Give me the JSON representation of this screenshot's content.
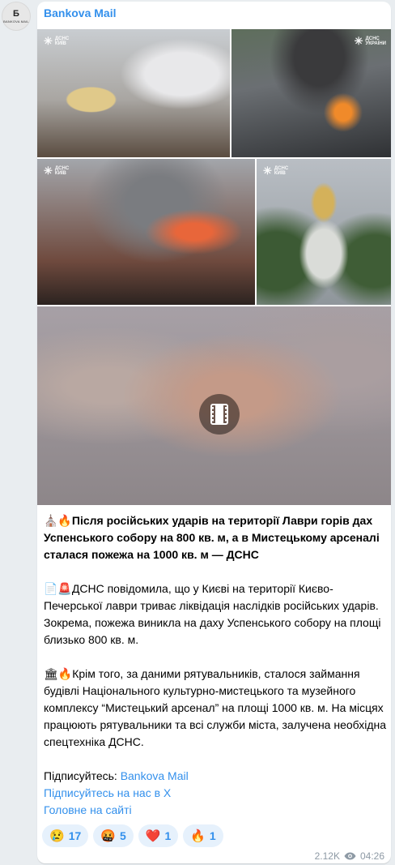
{
  "channel": {
    "name": "Bankova Mail",
    "avatar_glyph": "Б",
    "avatar_caption": "BANKOVA MAIL"
  },
  "photos": {
    "watermark_top": "ДСНС",
    "watermark_kyiv": "КИЇВ",
    "watermark_ukr": "УКРАЇНИ"
  },
  "post": {
    "headline_emoji": "⛪🔥",
    "headline": "Після російських ударів на території Лаври горів дах Успенського собору на 800 кв. м, а в Мистецькому арсеналі сталася пожежа на 1000 кв. м — ДСНС",
    "p1_emoji": "📄🚨",
    "p1": "ДСНС повідомила, що у Києві на території Києво-Печерської лаври триває ліквідація наслідків російських ударів. Зокрема, пожежа виникла на даху Успенського собору на площі близько 800 кв. м.",
    "p2_emoji": "🏛🔥",
    "p2": "Крім того, за даними рятувальників, сталося займання будівлі Національного культурно-мистецького та музейного комплексу “Мистецький арсенал” на площі 1000 кв. м. На місцях працюють рятувальники та всі служби міста, залучена необхідна спецтехніка ДСНС.",
    "subscribe_prefix": "Підписуйтесь: ",
    "subscribe_link": "Bankova Mail",
    "x_link": "Підписуйтесь на нас в X",
    "site_link": "Головне на сайті"
  },
  "reactions": [
    {
      "emoji": "😢",
      "count": "17"
    },
    {
      "emoji": "🤬",
      "count": "5"
    },
    {
      "emoji": "❤️",
      "count": "1"
    },
    {
      "emoji": "🔥",
      "count": "1"
    }
  ],
  "meta": {
    "views": "2.12K",
    "time": "04:26"
  },
  "colors": {
    "accent": "#3390ec",
    "background": "#e9edf0",
    "bubble": "#ffffff",
    "reaction_bg": "#e6f1fc"
  }
}
